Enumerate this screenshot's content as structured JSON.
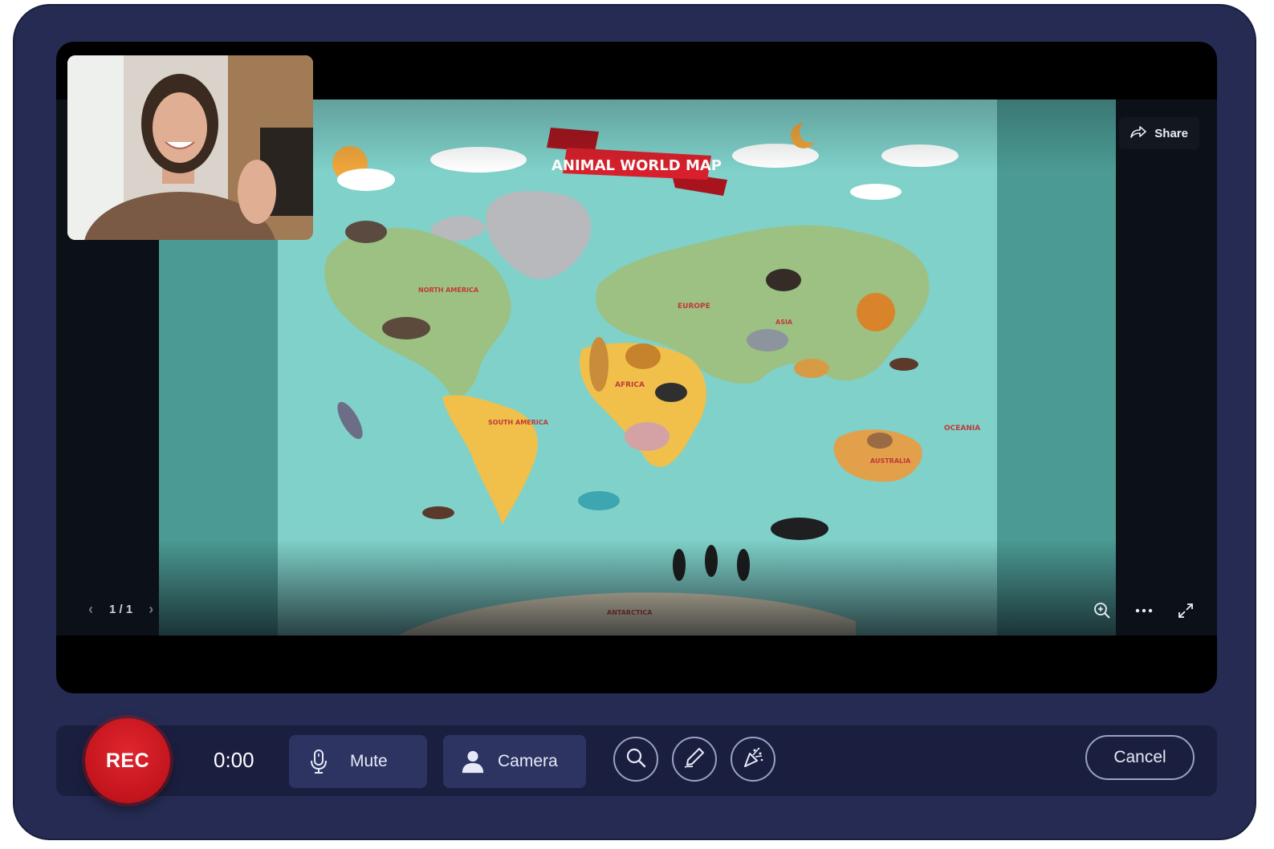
{
  "slide": {
    "title": "ANIMAL WORLD MAP",
    "regions": {
      "north_america": "NORTH AMERICA",
      "south_america": "SOUTH AMERICA",
      "europe": "EUROPE",
      "asia": "ASIA",
      "africa": "AFRICA",
      "oceania": "OCEANIA",
      "australia": "AUSTRALIA",
      "antarctica": "ANTARCTICA"
    }
  },
  "viewer": {
    "share_label": "Share",
    "page_indicator": "1 / 1",
    "prev_icon": "chevron-left-icon",
    "next_icon": "chevron-right-icon",
    "tools": [
      "zoom-in-icon",
      "more-icon",
      "expand-icon"
    ]
  },
  "controls": {
    "rec_label": "REC",
    "timer": "0:00",
    "mute_label": "Mute",
    "camera_label": "Camera",
    "cancel_label": "Cancel",
    "icons": [
      "microphone-icon",
      "person-icon",
      "search-icon",
      "pen-icon",
      "confetti-icon"
    ]
  },
  "colors": {
    "frame": "#252b52",
    "controls_bar": "#1a1f3f",
    "button": "#2d3462",
    "rec": "#c3141d",
    "ocean": "#7fd1c9",
    "land": "#9cc183",
    "africa": "#f1c04a",
    "banner": "#d7202b"
  }
}
